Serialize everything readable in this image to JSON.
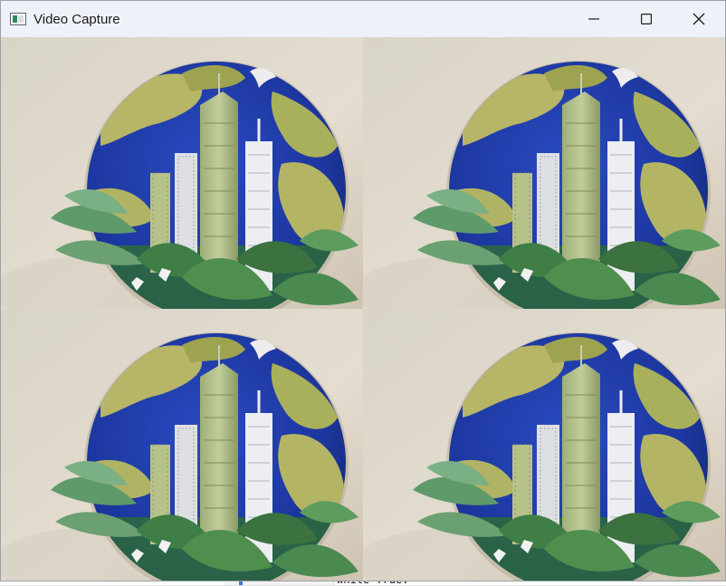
{
  "window": {
    "title": "Video Capture",
    "icon": "app-window-icon",
    "controls": [
      "minimize-icon",
      "maximize-icon",
      "close-icon"
    ]
  },
  "video": {
    "layout": "2x2 grid",
    "tiles": [
      {
        "name": "top-left"
      },
      {
        "name": "top-right"
      },
      {
        "name": "bottom-left"
      },
      {
        "name": "bottom-right"
      }
    ],
    "scene": "paper-art globe with skyscrapers, plants, a dove and butterflies"
  },
  "background_editor": {
    "code_line": "while True:"
  }
}
